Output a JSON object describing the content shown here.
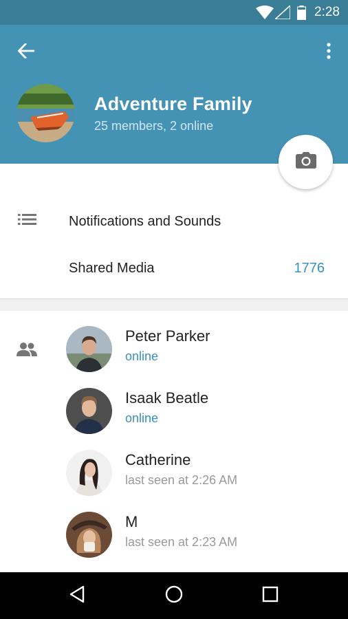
{
  "status_bar": {
    "time": "2:28",
    "icons": [
      "wifi-icon",
      "signal-icon",
      "battery-icon"
    ]
  },
  "header": {
    "back_icon": "arrow-left-icon",
    "more_icon": "more-vertical-icon",
    "title": "Adventure Family",
    "subtitle": "25 members, 2 online",
    "background_color": "#4593b4"
  },
  "camera_button": {
    "icon": "camera-icon"
  },
  "settings": {
    "notifications_label": "Notifications and Sounds",
    "notifications_icon": "list-icon",
    "shared_media_label": "Shared Media",
    "shared_media_count": "1776"
  },
  "members": {
    "section_icon": "group-icon",
    "list": [
      {
        "name": "Peter Parker",
        "status": "online",
        "online": true
      },
      {
        "name": "Isaak Beatle",
        "status": "online",
        "online": true
      },
      {
        "name": "Catherine",
        "status": "last seen at 2:26 AM",
        "online": false
      },
      {
        "name": "M",
        "status": "last seen at 2:23 AM",
        "online": false
      }
    ]
  },
  "nav_bar": {
    "icons": [
      "back-triangle-icon",
      "home-circle-icon",
      "recents-square-icon"
    ]
  },
  "colors": {
    "accent": "#3a8fc2",
    "header": "#4593b4",
    "status_bar": "#3a7d97"
  }
}
